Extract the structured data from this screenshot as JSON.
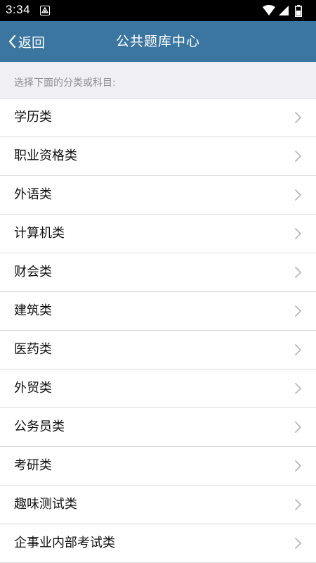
{
  "status_bar": {
    "time": "3:34",
    "icons": [
      "notification-icon",
      "wifi-icon",
      "signal-icon",
      "battery-icon"
    ]
  },
  "app_bar": {
    "back_label": "返回",
    "title": "公共题库中心",
    "background": "#3a76a0"
  },
  "section": {
    "header": "选择下面的分类或科目:"
  },
  "categories": [
    {
      "label": "学历类"
    },
    {
      "label": "职业资格类"
    },
    {
      "label": "外语类"
    },
    {
      "label": "计算机类"
    },
    {
      "label": "财会类"
    },
    {
      "label": "建筑类"
    },
    {
      "label": "医药类"
    },
    {
      "label": "外贸类"
    },
    {
      "label": "公务员类"
    },
    {
      "label": "考研类"
    },
    {
      "label": "趣味测试类"
    },
    {
      "label": "企事业内部考试类"
    }
  ]
}
